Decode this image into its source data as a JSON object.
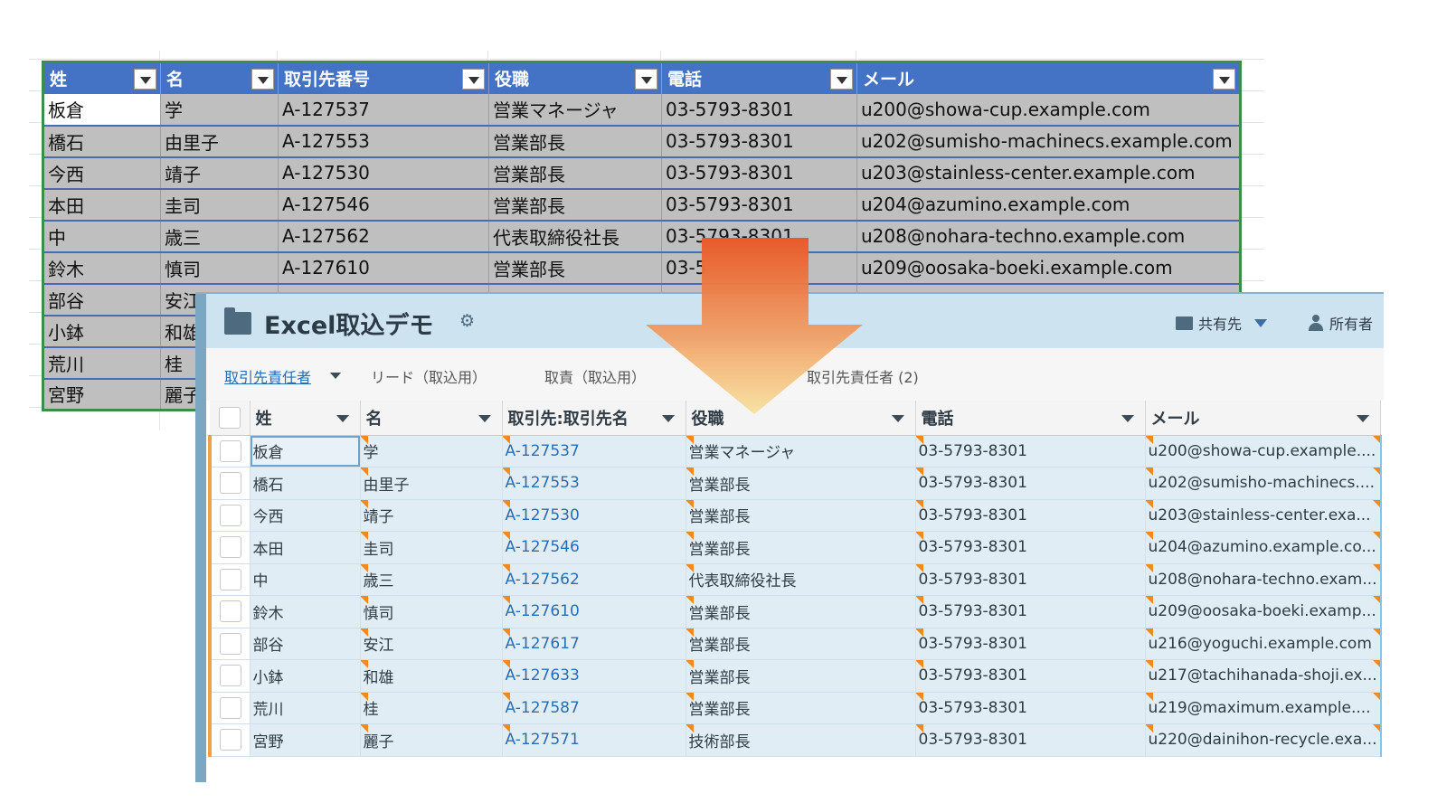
{
  "excel": {
    "headers": [
      "姓",
      "名",
      "取引先番号",
      "役職",
      "電話",
      "メール"
    ],
    "rows": [
      [
        "板倉",
        "学",
        "A-127537",
        "営業マネージャ",
        "03-5793-8301",
        "u200@showa-cup.example.com"
      ],
      [
        "橋石",
        "由里子",
        "A-127553",
        "営業部長",
        "03-5793-8301",
        "u202@sumisho-machinecs.example.com"
      ],
      [
        "今西",
        "靖子",
        "A-127530",
        "営業部長",
        "03-5793-8301",
        "u203@stainless-center.example.com"
      ],
      [
        "本田",
        "圭司",
        "A-127546",
        "営業部長",
        "03-5793-8301",
        "u204@azumino.example.com"
      ],
      [
        "中",
        "歳三",
        "A-127562",
        "代表取締役社長",
        "03-5793-8301",
        "u208@nohara-techno.example.com"
      ],
      [
        "鈴木",
        "慎司",
        "A-127610",
        "営業部長",
        "03-5",
        "u209@oosaka-boeki.example.com"
      ],
      [
        "部谷",
        "安江",
        "",
        "",
        "",
        ""
      ],
      [
        "小鉢",
        "和雄",
        "",
        "",
        "",
        ""
      ],
      [
        "荒川",
        "桂",
        "",
        "",
        "",
        ""
      ],
      [
        "宮野",
        "麗子",
        "",
        "",
        "",
        ""
      ]
    ]
  },
  "salesforce": {
    "title": "Excel取込デモ",
    "shared_label": "共有先",
    "owner_label": "所有者",
    "tabs": [
      "取引先責任者",
      "リード（取込用）",
      "取責（取込用）",
      "取引先責任者 (2)"
    ],
    "columns": [
      "姓",
      "名",
      "取引先:取引先名",
      "役職",
      "電話",
      "メール"
    ],
    "rows": [
      [
        "板倉",
        "学",
        "A-127537",
        "営業マネージャ",
        "03-5793-8301",
        "u200@showa-cup.example...."
      ],
      [
        "橋石",
        "由里子",
        "A-127553",
        "営業部長",
        "03-5793-8301",
        "u202@sumisho-machinecs...."
      ],
      [
        "今西",
        "靖子",
        "A-127530",
        "営業部長",
        "03-5793-8301",
        "u203@stainless-center.exa..."
      ],
      [
        "本田",
        "圭司",
        "A-127546",
        "営業部長",
        "03-5793-8301",
        "u204@azumino.example.co..."
      ],
      [
        "中",
        "歳三",
        "A-127562",
        "代表取締役社長",
        "03-5793-8301",
        "u208@nohara-techno.exam..."
      ],
      [
        "鈴木",
        "慎司",
        "A-127610",
        "営業部長",
        "03-5793-8301",
        "u209@oosaka-boeki.examp..."
      ],
      [
        "部谷",
        "安江",
        "A-127617",
        "営業部長",
        "03-5793-8301",
        "u216@yoguchi.example.com"
      ],
      [
        "小鉢",
        "和雄",
        "A-127633",
        "営業部長",
        "03-5793-8301",
        "u217@tachihanada-shoji.ex..."
      ],
      [
        "荒川",
        "桂",
        "A-127587",
        "営業部長",
        "03-5793-8301",
        "u219@maximum.example...."
      ],
      [
        "宮野",
        "麗子",
        "A-127571",
        "技術部長",
        "03-5793-8301",
        "u220@dainihon-recycle.exa..."
      ]
    ]
  },
  "colors": {
    "excel_header": "#4472c4",
    "excel_cell": "#bfbfbf",
    "sf_header": "#cde3ef",
    "sf_row": "#e1edf5",
    "arrow_top": "#e85a2a",
    "arrow_bottom": "#f7de95",
    "error_marker": "#f08a1c"
  }
}
